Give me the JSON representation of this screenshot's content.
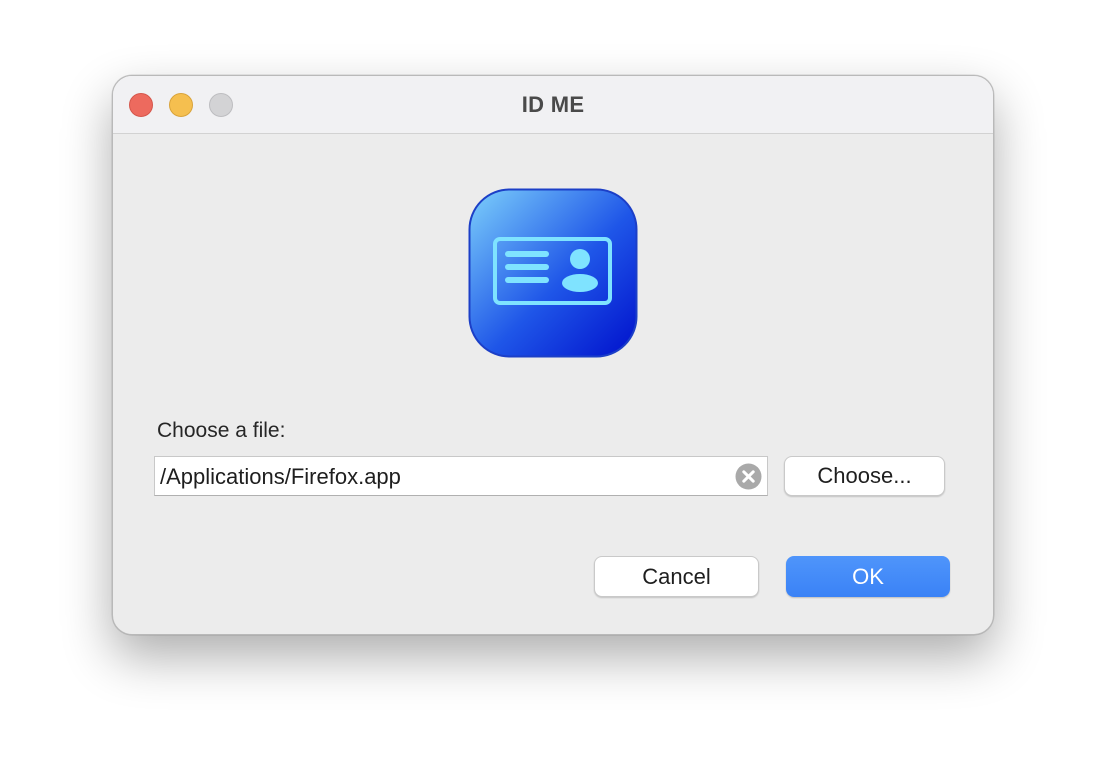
{
  "window": {
    "title": "ID ME"
  },
  "icon": {
    "name": "id-card-app-icon",
    "gradient": [
      "#7dd0fb",
      "#1f56e8",
      "#0010cc"
    ],
    "glyph_color": "#7fe3ff"
  },
  "file_chooser": {
    "label": "Choose a file:",
    "path_value": "/Applications/Firefox.app",
    "clear_icon": "x-circle-icon",
    "choose_button_label": "Choose..."
  },
  "actions": {
    "cancel_label": "Cancel",
    "ok_label": "OK",
    "accent_color": "#3d86f7"
  }
}
